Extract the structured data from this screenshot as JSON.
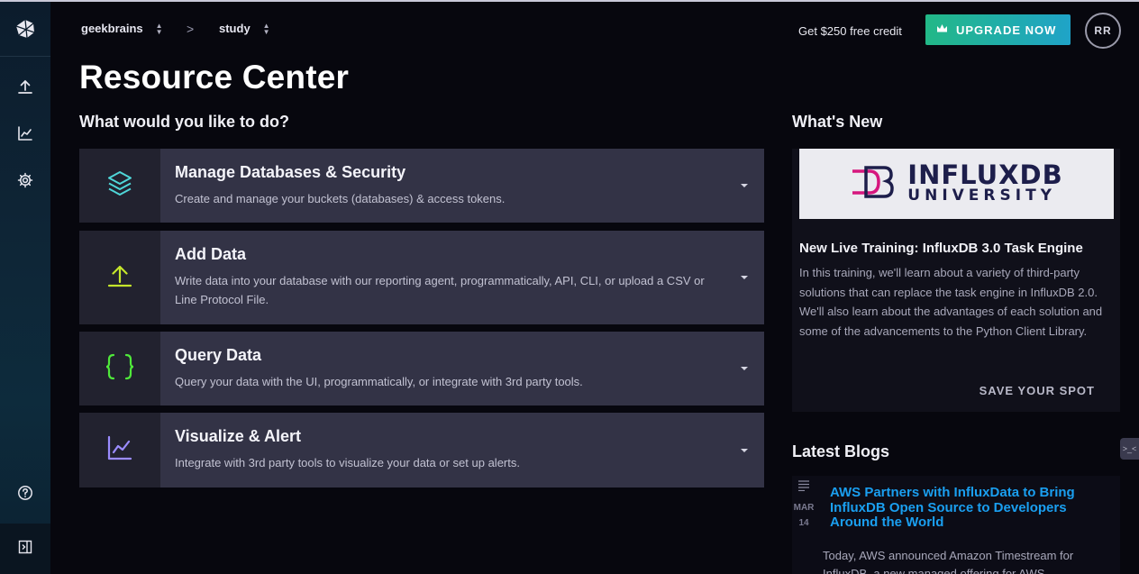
{
  "breadcrumb": {
    "org": "geekbrains",
    "bucket": "study",
    "separator": ">"
  },
  "header": {
    "credit_text": "Get $250 free credit",
    "upgrade_label": "UPGRADE NOW",
    "avatar_initials": "RR"
  },
  "page": {
    "title": "Resource Center",
    "actions_heading": "What would you like to do?"
  },
  "actions": [
    {
      "title": "Manage Databases & Security",
      "desc": "Create and manage your buckets (databases) & access tokens.",
      "icon": "layers-icon",
      "color": "#4fd6d8"
    },
    {
      "title": "Add Data",
      "desc": "Write data into your database with our reporting agent, programmatically, API, CLI, or upload a CSV or Line Protocol File.",
      "icon": "upload-icon",
      "color": "#c5e52b"
    },
    {
      "title": "Query Data",
      "desc": "Query your data with the UI, programmatically, or integrate with 3rd party tools.",
      "icon": "braces-icon",
      "color": "#4fe83a"
    },
    {
      "title": "Visualize & Alert",
      "desc": "Integrate with 3rd party tools to visualize your data or set up alerts.",
      "icon": "chart-icon",
      "color": "#9b8cff"
    }
  ],
  "whats_new": {
    "heading": "What's New",
    "image_brand": "INFLUXDB",
    "image_sub": "UNIVERSITY",
    "title": "New Live Training: InfluxDB 3.0 Task Engine",
    "desc": "In this training, we'll learn about a variety of third-party solutions that can replace the task engine in InfluxDB 2.0. We'll also learn about the advantages of each solution and some of the advancements to the Python Client Library.",
    "cta": "SAVE YOUR SPOT"
  },
  "blogs": {
    "heading": "Latest Blogs",
    "items": [
      {
        "month": "MAR",
        "day": "14",
        "title": "AWS Partners with InfluxData to Bring InfluxDB Open Source to Developers Around the World",
        "excerpt": "Today, AWS announced Amazon Timestream for InfluxDB, a new managed offering for AWS"
      }
    ]
  },
  "edge_tab": {
    "label": ">_<"
  },
  "colors": {
    "brand_gradient_start": "#22b887",
    "brand_gradient_end": "#1fa3c8",
    "card_bg": "#333346",
    "link": "#1a9ff0",
    "logo_magenta": "#d6177e"
  }
}
